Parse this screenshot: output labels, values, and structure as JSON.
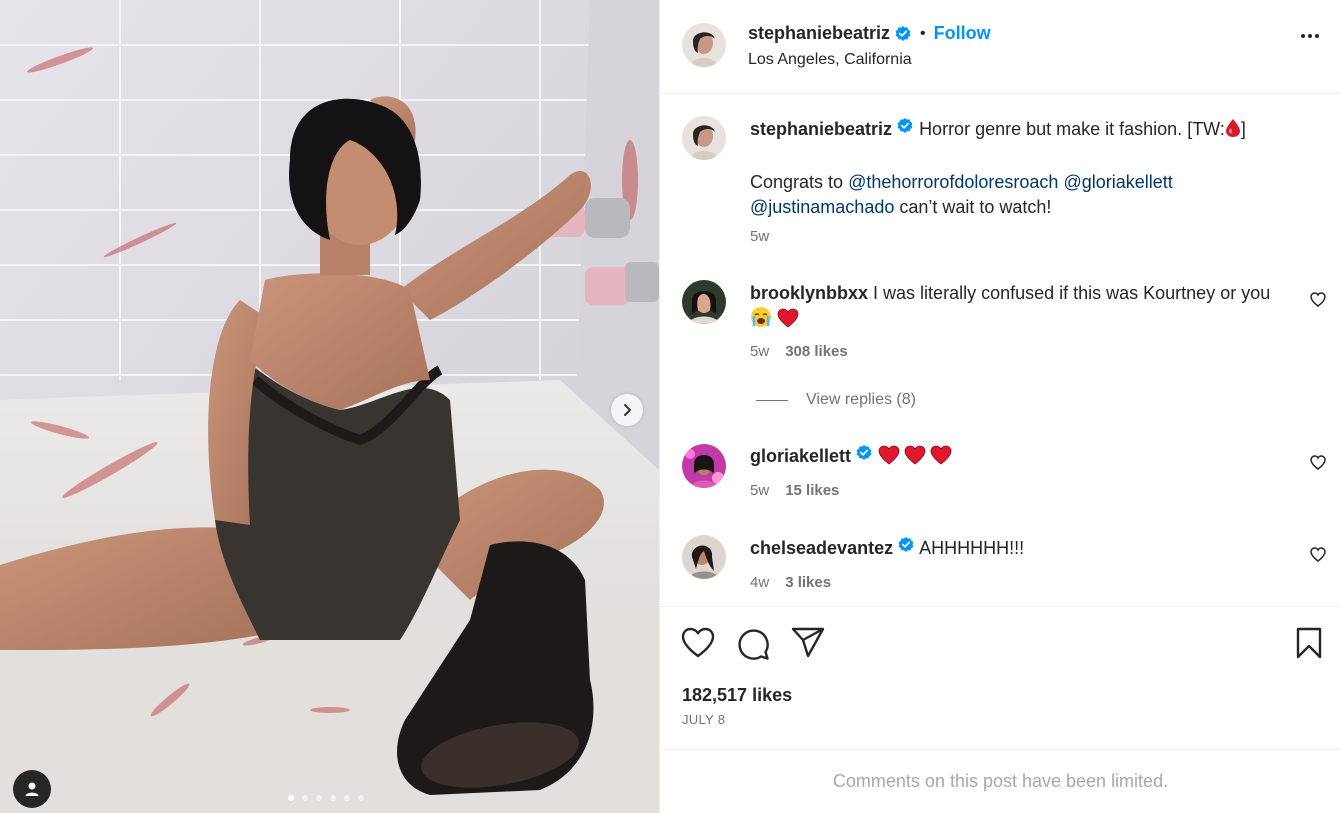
{
  "media": {
    "carousel_count": 6,
    "carousel_active": 1
  },
  "header": {
    "username": "stephaniebeatriz",
    "separator": "•",
    "follow_label": "Follow",
    "location": "Los Angeles, California"
  },
  "caption": {
    "username": "stephaniebeatriz",
    "text": "Horror genre but make it fashion. [TW:",
    "text_end": "]",
    "line2_prefix": "Congrats to ",
    "mention1": "@thehorrorofdoloresroach",
    "mention2": "@gloriakellett",
    "mention3": "@justinamachado",
    "line2_suffix": " can’t wait to watch!",
    "time": "5w"
  },
  "comments": [
    {
      "username": "brooklynbbxx",
      "text": "I was literally confused if this was Kourtney or you",
      "time": "5w",
      "likes": "308 likes"
    },
    {
      "username": "gloriakellett",
      "text": "",
      "time": "5w",
      "likes": "15 likes"
    },
    {
      "username": "chelseadevantez",
      "text": "AHHHHHH!!!",
      "time": "4w",
      "likes": "3 likes"
    }
  ],
  "view_replies": "View replies (8)",
  "post": {
    "likes": "182,517 likes",
    "date": "JULY 8",
    "limited_notice": "Comments on this post have been limited."
  },
  "icons": {
    "like": "heart-icon",
    "comment": "comment-icon",
    "share": "share-icon",
    "save": "bookmark-icon",
    "verified": "verified-badge-icon",
    "more": "more-options-icon",
    "next": "chevron-right-icon",
    "tags": "user-tag-icon"
  },
  "colors": {
    "accent": "#0095f6",
    "mention": "#00376b",
    "verified": "#0095f6",
    "muted": "#737373"
  }
}
